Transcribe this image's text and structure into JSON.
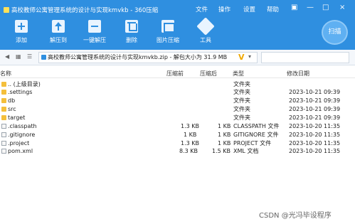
{
  "window": {
    "title": "高校教师公寓管理系统的设计与实现kmvkb - 360压缩",
    "menus": [
      "文件",
      "操作",
      "设置",
      "帮助"
    ]
  },
  "toolbar": {
    "items": [
      {
        "label": "添加",
        "icon": "add-icon"
      },
      {
        "label": "解压到",
        "icon": "extract-to-icon"
      },
      {
        "label": "一键解压",
        "icon": "one-click-extract-icon"
      },
      {
        "label": "删除",
        "icon": "delete-icon"
      },
      {
        "label": "图片压缩",
        "icon": "image-compress-icon"
      },
      {
        "label": "工具",
        "icon": "tools-icon"
      }
    ],
    "scan_label": "扫描"
  },
  "address": {
    "path": "高校教师公寓管理系统的设计与实现kmvkb.zip - 解包大小为 31.9 MB"
  },
  "columns": {
    "name": "名称",
    "original_size": "压缩前",
    "compressed_size": "压缩后",
    "type": "类型",
    "modified": "修改日期"
  },
  "files": [
    {
      "name": ".. (上级目录)",
      "original_size": "",
      "compressed_size": "",
      "type": "文件夹",
      "modified": "",
      "is_folder": true
    },
    {
      "name": ".settings",
      "original_size": "",
      "compressed_size": "",
      "type": "文件夹",
      "modified": "2023-10-21 09:39",
      "is_folder": true
    },
    {
      "name": "db",
      "original_size": "",
      "compressed_size": "",
      "type": "文件夹",
      "modified": "2023-10-21 09:39",
      "is_folder": true
    },
    {
      "name": "src",
      "original_size": "",
      "compressed_size": "",
      "type": "文件夹",
      "modified": "2023-10-21 09:39",
      "is_folder": true
    },
    {
      "name": "target",
      "original_size": "",
      "compressed_size": "",
      "type": "文件夹",
      "modified": "2023-10-21 09:39",
      "is_folder": true
    },
    {
      "name": ".classpath",
      "original_size": "1.3 KB",
      "compressed_size": "1 KB",
      "type": "CLASSPATH 文件",
      "modified": "2023-10-20 11:35",
      "is_folder": false
    },
    {
      "name": ".gitignore",
      "original_size": "1 KB",
      "compressed_size": "1 KB",
      "type": "GITIGNORE 文件",
      "modified": "2023-10-20 11:35",
      "is_folder": false
    },
    {
      "name": ".project",
      "original_size": "1.3 KB",
      "compressed_size": "1 KB",
      "type": "PROJECT 文件",
      "modified": "2023-10-20 11:35",
      "is_folder": false
    },
    {
      "name": "pom.xml",
      "original_size": "8.3 KB",
      "compressed_size": "1.5 KB",
      "type": "XML 文档",
      "modified": "2023-10-20 11:35",
      "is_folder": false
    }
  ],
  "watermark": "CSDN @光冯毕设程序",
  "colors": {
    "title_bar": "#2f8fe0",
    "folder": "#f4bf3b"
  }
}
